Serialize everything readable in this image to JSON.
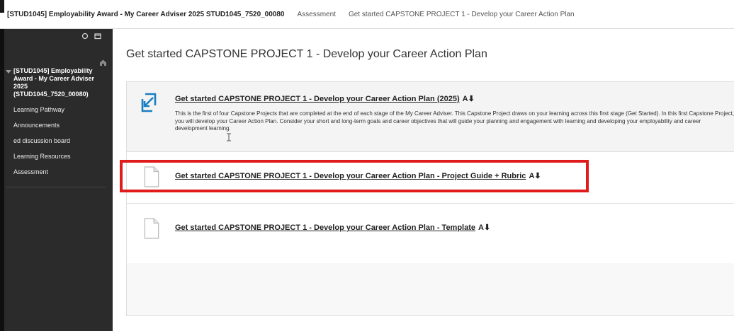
{
  "breadcrumb": {
    "course": "[STUD1045] Employability Award - My Career Adviser 2025 STUD1045_7520_00080",
    "items": [
      "Assessment",
      "Get started CAPSTONE PROJECT 1 - Develop your Career Action Plan"
    ]
  },
  "sidebar": {
    "course_title": "[STUD1045] Employability Award - My Career Adviser 2025 (STUD1045_7520_00080)",
    "items": [
      {
        "label": "Learning Pathway"
      },
      {
        "label": "Announcements"
      },
      {
        "label": "ed discussion board"
      },
      {
        "label": "Learning Resources"
      },
      {
        "label": "Assessment"
      }
    ]
  },
  "main": {
    "title": "Get started CAPSTONE PROJECT 1 - Develop your Career Action Plan",
    "items": [
      {
        "title": "Get started CAPSTONE PROJECT 1 - Develop your Career Action Plan (2025)",
        "description": "This is the first of four Capstone Projects that are completed at the end of each stage of the My Career Adviser. This Capstone Project draws on your learning across this first stage (Get Started). In this first Capstone Project, you will develop your Career Action Plan. Consider your short and long-term goals and career objectives that will guide your planning and engagement with learning and developing your employability and career development learning.",
        "icon": "link-arrow-icon"
      },
      {
        "title": "Get started CAPSTONE PROJECT 1 - Develop your Career Action Plan - Project Guide + Rubric",
        "icon": "document-icon"
      },
      {
        "title": "Get started CAPSTONE PROJECT 1 - Develop your Career Action Plan - Template",
        "icon": "document-icon"
      }
    ]
  },
  "colors": {
    "sidebar_bg": "#2b2b2b",
    "highlight": "#e01b1b",
    "link_icon": "#1a7fc1"
  }
}
